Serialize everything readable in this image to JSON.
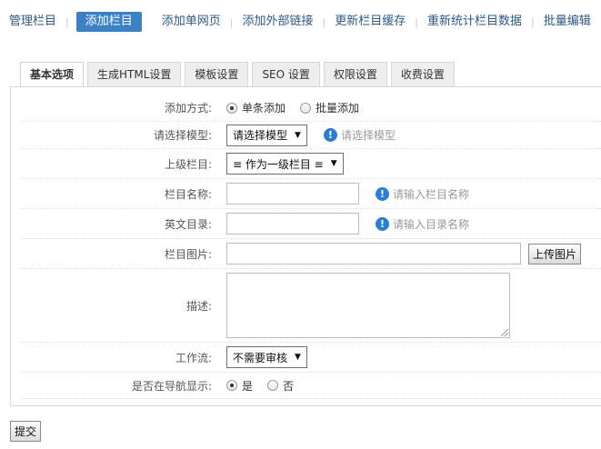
{
  "topnav": {
    "items": [
      "管理栏目",
      "添加栏目",
      "添加单网页",
      "添加外部链接",
      "更新栏目缓存",
      "重新统计栏目数据",
      "批量编辑"
    ],
    "active_index": 1
  },
  "tabs": [
    "基本选项",
    "生成HTML设置",
    "模板设置",
    "SEO 设置",
    "权限设置",
    "收费设置"
  ],
  "form": {
    "add_method": {
      "label": "添加方式:",
      "options": [
        "单条添加",
        "批量添加"
      ],
      "selected": "单条添加"
    },
    "model": {
      "label": "请选择模型:",
      "value": "请选择模型",
      "hint": "请选择模型"
    },
    "parent": {
      "label": "上级栏目:",
      "value": "≡ 作为一级栏目 ≡"
    },
    "name": {
      "label": "栏目名称:",
      "value": "",
      "hint": "请输入栏目名称"
    },
    "dir": {
      "label": "英文目录:",
      "value": "",
      "hint": "请输入目录名称"
    },
    "image": {
      "label": "栏目图片:",
      "value": "",
      "button": "上传图片"
    },
    "desc": {
      "label": "描述:",
      "value": ""
    },
    "workflow": {
      "label": "工作流:",
      "value": "不需要审核"
    },
    "nav": {
      "label": "是否在导航显示:",
      "options": [
        "是",
        "否"
      ],
      "selected": "是"
    }
  },
  "submit_label": "提交",
  "colors": {
    "accent": "#3c81c5",
    "hint_icon": "#2a7fd4",
    "nav_text": "#2c5a86"
  },
  "icons": {
    "hint": "info-icon",
    "select": "triangle-down-icon"
  }
}
